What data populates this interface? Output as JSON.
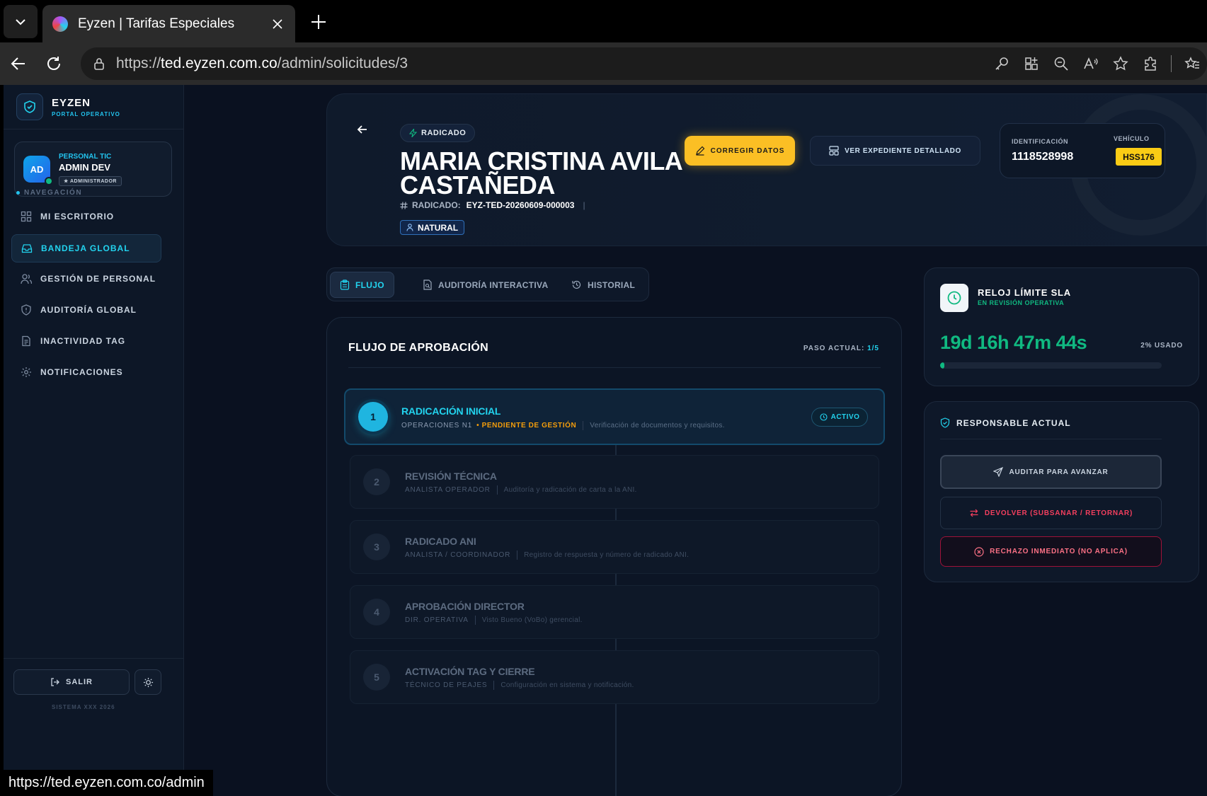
{
  "browser": {
    "tab_title": "Eyzen | Tarifas Especiales",
    "url_scheme": "https://",
    "url_host": "ted.eyzen.com.co",
    "url_path": "/admin/solicitudes/3",
    "status_url": "https://ted.eyzen.com.co/admin"
  },
  "brand": {
    "title": "EYZEN",
    "subtitle": "PORTAL OPERATIVO"
  },
  "user": {
    "initials": "AD",
    "role": "PERSONAL TIC",
    "name": "ADMIN DEV",
    "badge": "★ ADMINISTRADOR"
  },
  "nav": {
    "section_label": "NAVEGACIÓN",
    "items": [
      {
        "label": "MI ESCRITORIO",
        "icon": "dashboard-icon"
      },
      {
        "label": "BANDEJA GLOBAL",
        "icon": "inbox-icon",
        "active": true
      },
      {
        "label": "GESTIÓN DE PERSONAL",
        "icon": "users-icon"
      },
      {
        "label": "AUDITORÍA GLOBAL",
        "icon": "shield-alert-icon"
      },
      {
        "label": "INACTIVIDAD TAG",
        "icon": "document-icon"
      },
      {
        "label": "NOTIFICACIONES",
        "icon": "settings-icon"
      }
    ],
    "logout_label": "SALIR",
    "version": "SISTEMA XXX 2026"
  },
  "header": {
    "status": "RADICADO",
    "name": "MARIA CRISTINA AVILA CASTAÑEDA",
    "radicado_label": "RADICADO:",
    "radicado_value": "EYZ-TED-20260609-000003",
    "person_type": "NATURAL",
    "correct_button": "CORREGIR DATOS",
    "expediente_button": "VER EXPEDIENTE DETALLADO",
    "id_label": "IDENTIFICACIÓN",
    "id_value": "1118528998",
    "vehicle_label": "VEHÍCULO",
    "plate": "HSS176"
  },
  "tabs": [
    {
      "label": "FLUJO",
      "icon": "clipboard-icon",
      "active": true
    },
    {
      "label": "AUDITORÍA INTERACTIVA",
      "icon": "file-search-icon"
    },
    {
      "label": "HISTORIAL",
      "icon": "history-icon"
    }
  ],
  "flow": {
    "title": "FLUJO DE APROBACIÓN",
    "step_label": "PASO ACTUAL:",
    "step_current": "1/5",
    "active_badge": "ACTIVO",
    "steps": [
      {
        "num": "1",
        "name": "RADICACIÓN INICIAL",
        "role": "OPERACIONES N1",
        "state": "• PENDIENTE DE GESTIÓN",
        "desc": "Verificación de documentos y requisitos.",
        "active": true
      },
      {
        "num": "2",
        "name": "REVISIÓN TÉCNICA",
        "role": "ANALISTA OPERADOR",
        "desc": "Auditoría y radicación de carta a la ANI."
      },
      {
        "num": "3",
        "name": "RADICADO ANI",
        "role": "ANALISTA / COORDINADOR",
        "desc": "Registro de respuesta y número de radicado ANI."
      },
      {
        "num": "4",
        "name": "APROBACIÓN DIRECTOR",
        "role": "DIR. OPERATIVA",
        "desc": "Visto Bueno (VoBo) gerencial."
      },
      {
        "num": "5",
        "name": "ACTIVACIÓN TAG Y CIERRE",
        "role": "TÉCNICO DE PEAJES",
        "desc": "Configuración en sistema y notificación."
      }
    ]
  },
  "sla": {
    "title": "RELOJ LÍMITE SLA",
    "subtitle": "EN REVISIÓN OPERATIVA",
    "timer": "19d 16h 47m 44s",
    "used_label": "2% USADO",
    "used_fraction": 0.02,
    "color": "#10b981"
  },
  "responsible": {
    "title": "RESPONSABLE ACTUAL",
    "audit_button": "AUDITAR PARA AVANZAR",
    "return_button": "DEVOLVER (SUBSANAR / RETORNAR)",
    "reject_button": "RECHAZO INMEDIATO (NO APLICA)"
  }
}
